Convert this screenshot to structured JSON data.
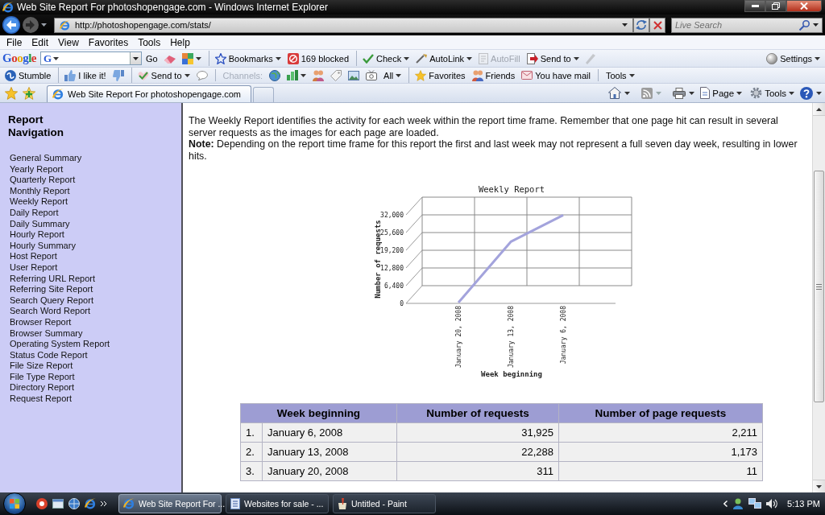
{
  "window": {
    "title": "Web Site Report For photoshopengage.com - Windows Internet Explorer"
  },
  "address_bar": {
    "url": "http://photoshopengage.com/stats/"
  },
  "search": {
    "placeholder": "Live Search"
  },
  "menu_bar": [
    "File",
    "Edit",
    "View",
    "Favorites",
    "Tools",
    "Help"
  ],
  "google_toolbar": {
    "logo": "Google",
    "engine": "G",
    "go": "Go",
    "buttons": [
      {
        "kind": "eraser",
        "dropdown": false,
        "disabled": false,
        "separator": false
      },
      {
        "kind": "palette",
        "dropdown": true,
        "disabled": false,
        "separator": false
      },
      {
        "kind": "bookmarks",
        "label": "Bookmarks",
        "dropdown": true,
        "disabled": false,
        "separator": true
      },
      {
        "kind": "popup-blocker",
        "label": "169 blocked",
        "dropdown": false,
        "disabled": false,
        "separator": false
      },
      {
        "kind": "spellcheck",
        "label": "Check",
        "dropdown": true,
        "disabled": false,
        "separator": true
      },
      {
        "kind": "autolink",
        "label": "AutoLink",
        "dropdown": true,
        "disabled": false,
        "separator": false
      },
      {
        "kind": "autofill",
        "label": "AutoFill",
        "dropdown": false,
        "disabled": true,
        "separator": false
      },
      {
        "kind": "send",
        "label": "Send to",
        "dropdown": true,
        "disabled": false,
        "separator": false
      },
      {
        "kind": "pen",
        "dropdown": false,
        "disabled": true,
        "separator": false
      }
    ],
    "settings": "Settings"
  },
  "stumble_toolbar": {
    "buttons": [
      {
        "kind": "stumble",
        "label": "Stumble",
        "dropdown": false,
        "separator": false
      },
      {
        "kind": "like",
        "label": "I like it!",
        "dropdown": false,
        "separator": true
      },
      {
        "kind": "dislike",
        "dropdown": false,
        "separator": false
      },
      {
        "kind": "share",
        "label": "Send to",
        "dropdown": true,
        "separator": true
      },
      {
        "kind": "comment",
        "dropdown": false,
        "separator": false
      }
    ],
    "channels": {
      "label": "Channels:",
      "all": "All"
    },
    "links": [
      {
        "kind": "favorites",
        "label": "Favorites",
        "dropdown": false,
        "separator": true
      },
      {
        "kind": "friends",
        "label": "Friends",
        "dropdown": false,
        "separator": false
      },
      {
        "kind": "mail",
        "label": "You have mail",
        "dropdown": false,
        "separator": false
      }
    ],
    "tools": "Tools"
  },
  "tabs": [
    {
      "title": "Web Site Report For photoshopengage.com",
      "selected": true
    }
  ],
  "command_bar": {
    "page": "Page",
    "tools": "Tools"
  },
  "sidebar": {
    "title": "Report Navigation",
    "links": [
      "General Summary",
      "Yearly Report",
      "Quarterly Report",
      "Monthly Report",
      "Weekly Report",
      "Daily Report",
      "Daily Summary",
      "Hourly Report",
      "Hourly Summary",
      "Host Report",
      "User Report",
      "Referring URL Report",
      "Referring Site Report",
      "Search Query Report",
      "Search Word Report",
      "Browser Report",
      "Browser Summary",
      "Operating System Report",
      "Status Code Report",
      "File Size Report",
      "File Type Report",
      "Directory Report",
      "Request Report"
    ]
  },
  "report": {
    "intro": "The Weekly Report identifies the activity for each week within the report time frame. Remember that one page hit can result in several server requests as the images for each page are loaded.",
    "note": "**Note:** Depending on the report time frame for this report the first and last week may not represent a full seven day week, resulting in lower hits.",
    "chart_data": {
      "type": "line",
      "title": "Weekly Report",
      "xlabel": "Week beginning",
      "ylabel": "Number of requests",
      "categories": [
        "January 20, 2008",
        "January 13, 2008",
        "January 6, 2008"
      ],
      "series": [
        {
          "color": "#a3a3dc",
          "values": [
            311,
            22288,
            31925
          ]
        }
      ],
      "ylim": [
        0,
        32000
      ],
      "yticks": [
        {
          "value": 0,
          "label": "0"
        },
        {
          "value": 6400,
          "label": "6,400"
        },
        {
          "value": 12800,
          "label": "12,800"
        },
        {
          "value": 19200,
          "label": "19,200"
        },
        {
          "value": 25600,
          "label": "25,600"
        },
        {
          "value": 32000,
          "label": "32,000"
        }
      ],
      "grid": true
    }
  },
  "table": {
    "columns": [
      "Week beginning",
      "Number of requests",
      "Number of page requests"
    ],
    "rows": [
      {
        "number": "1.",
        "week": "January 6, 2008",
        "requests": "31,925",
        "page_requests": "2,211"
      },
      {
        "number": "2.",
        "week": "January 13, 2008",
        "requests": "22,288",
        "page_requests": "1,173"
      },
      {
        "number": "3.",
        "week": "January 20, 2008",
        "requests": "311",
        "page_requests": "11"
      }
    ]
  },
  "taskbar": {
    "tasks": [
      {
        "kind": "browser",
        "label": "Web Site Report For ...",
        "selected": true
      },
      {
        "kind": "document",
        "label": "Websites for sale - ...",
        "selected": false
      },
      {
        "kind": "paint",
        "label": "Untitled - Paint",
        "selected": false
      }
    ],
    "clock": "5:13 PM"
  }
}
